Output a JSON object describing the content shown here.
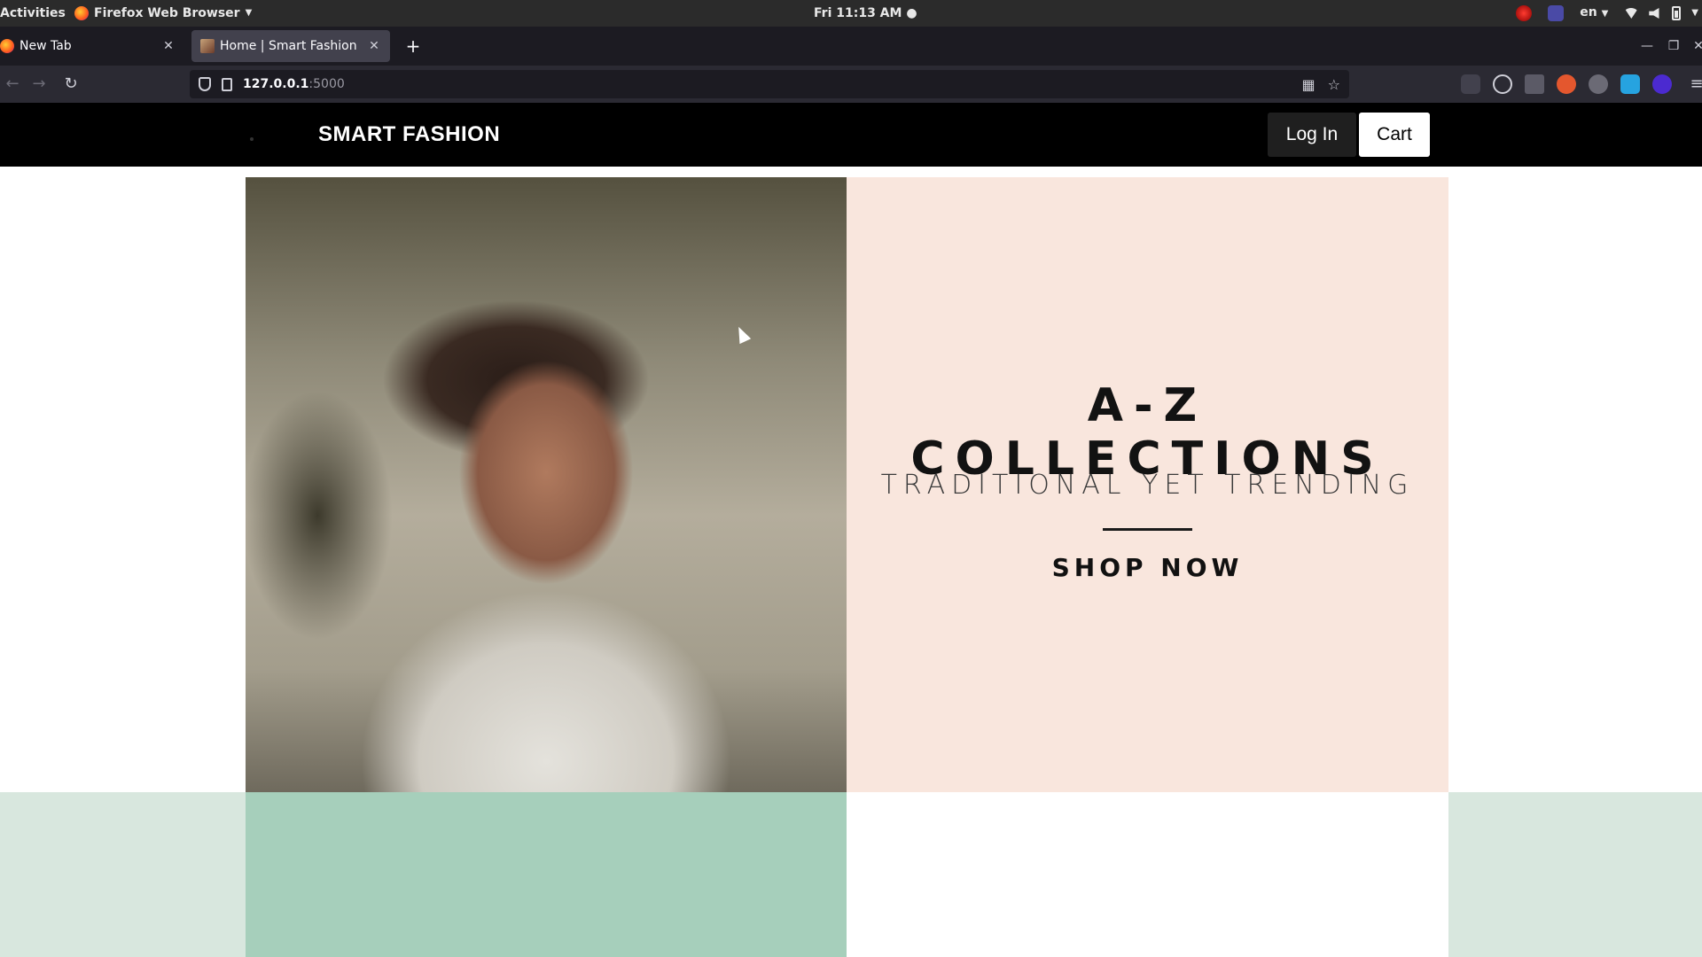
{
  "os_bar": {
    "activities": "Activities",
    "app_name": "Firefox Web Browser",
    "clock": "Fri 11:13 AM",
    "language": "en"
  },
  "browser": {
    "tabs": [
      {
        "title": "New Tab",
        "active": false
      },
      {
        "title": "Home | Smart Fashion",
        "active": true
      }
    ],
    "url": {
      "host": "127.0.0.1",
      "port": ":5000"
    }
  },
  "site": {
    "brand": "SMART FASHION",
    "nav": {
      "login_label": "Log In",
      "cart_label": "Cart"
    },
    "hero": {
      "title": "A-Z COLLECTIONS",
      "subtitle": "TRADITIONAL YET TRENDING",
      "cta": "SHOP NOW"
    }
  },
  "colors": {
    "header_bg": "#000000",
    "hero_panel_bg": "#f9e6dd",
    "band_green": "#a6cfbb",
    "band_light_green": "#d8e7de"
  }
}
